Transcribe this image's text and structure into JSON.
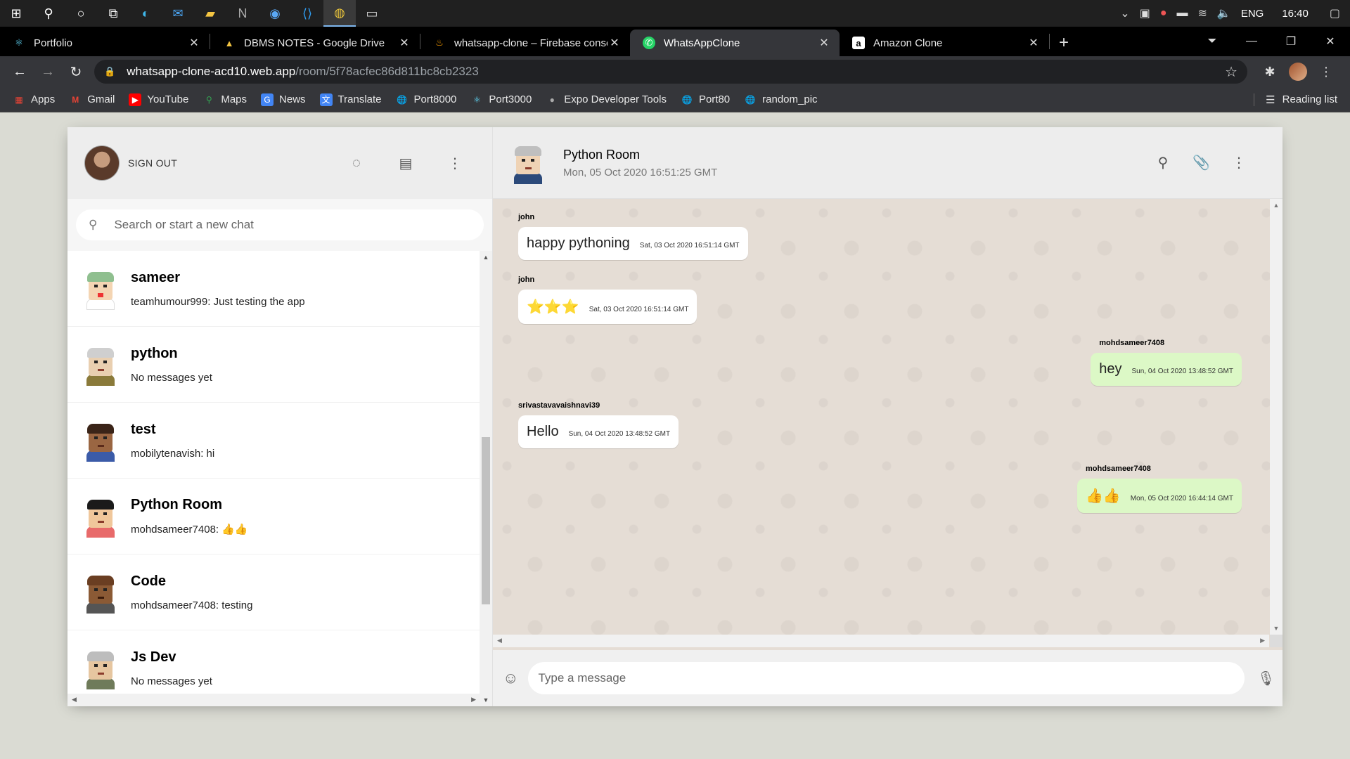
{
  "taskbar": {
    "lang": "ENG",
    "time": "16:40"
  },
  "tabs": [
    {
      "title": "Portfolio",
      "icon": "react-icon"
    },
    {
      "title": "DBMS NOTES - Google Drive",
      "icon": "drive-icon"
    },
    {
      "title": "whatsapp-clone – Firebase console",
      "icon": "firebase-icon"
    },
    {
      "title": "WhatsAppClone",
      "icon": "whatsapp-icon"
    },
    {
      "title": "Amazon Clone",
      "icon": "amazon-icon"
    }
  ],
  "address": {
    "host": "whatsapp-clone-acd10.web.app",
    "path": "/room/5f78acfec86d811bc8cb2323"
  },
  "bookmarks": [
    {
      "label": "Apps"
    },
    {
      "label": "Gmail"
    },
    {
      "label": "YouTube"
    },
    {
      "label": "Maps"
    },
    {
      "label": "News"
    },
    {
      "label": "Translate"
    },
    {
      "label": "Port8000"
    },
    {
      "label": "Port3000"
    },
    {
      "label": "Expo Developer Tools"
    },
    {
      "label": "Port80"
    },
    {
      "label": "random_pic"
    }
  ],
  "reading_list": "Reading list",
  "sidebar": {
    "signout": "SIGN OUT",
    "search_placeholder": "Search or start a new chat",
    "chats": [
      {
        "name": "sameer",
        "last": "teamhumour999: Just testing the app"
      },
      {
        "name": "python",
        "last": "No messages yet"
      },
      {
        "name": "test",
        "last": "mobilytenavish: hi"
      },
      {
        "name": "Python Room",
        "last": "mohdsameer7408: 👍👍"
      },
      {
        "name": "Code",
        "last": "mohdsameer7408: testing"
      },
      {
        "name": "Js Dev",
        "last": "No messages yet"
      }
    ]
  },
  "chat": {
    "room_name": "Python Room",
    "last_seen": "Mon, 05 Oct 2020 16:51:25 GMT",
    "messages": [
      {
        "author": "john",
        "text": "happy pythoning",
        "ts": "Sat, 03 Oct 2020 16:51:14 GMT",
        "mine": false
      },
      {
        "author": "john",
        "text": "⭐⭐⭐",
        "ts": "Sat, 03 Oct 2020 16:51:14 GMT",
        "mine": false
      },
      {
        "author": "mohdsameer7408",
        "text": "hey",
        "ts": "Sun, 04 Oct 2020 13:48:52 GMT",
        "mine": true
      },
      {
        "author": "srivastavavaishnavi39",
        "text": "Hello",
        "ts": "Sun, 04 Oct 2020 13:48:52 GMT",
        "mine": false
      },
      {
        "author": "mohdsameer7408",
        "text": "👍👍",
        "ts": "Mon, 05 Oct 2020 16:44:14 GMT",
        "mine": true
      }
    ],
    "input_placeholder": "Type a message"
  },
  "colors": {
    "app_bg": "#dadbd3",
    "header_bg": "#ededed",
    "chat_bg": "#e5ddd5",
    "mine_bubble": "#dcf8c6"
  }
}
